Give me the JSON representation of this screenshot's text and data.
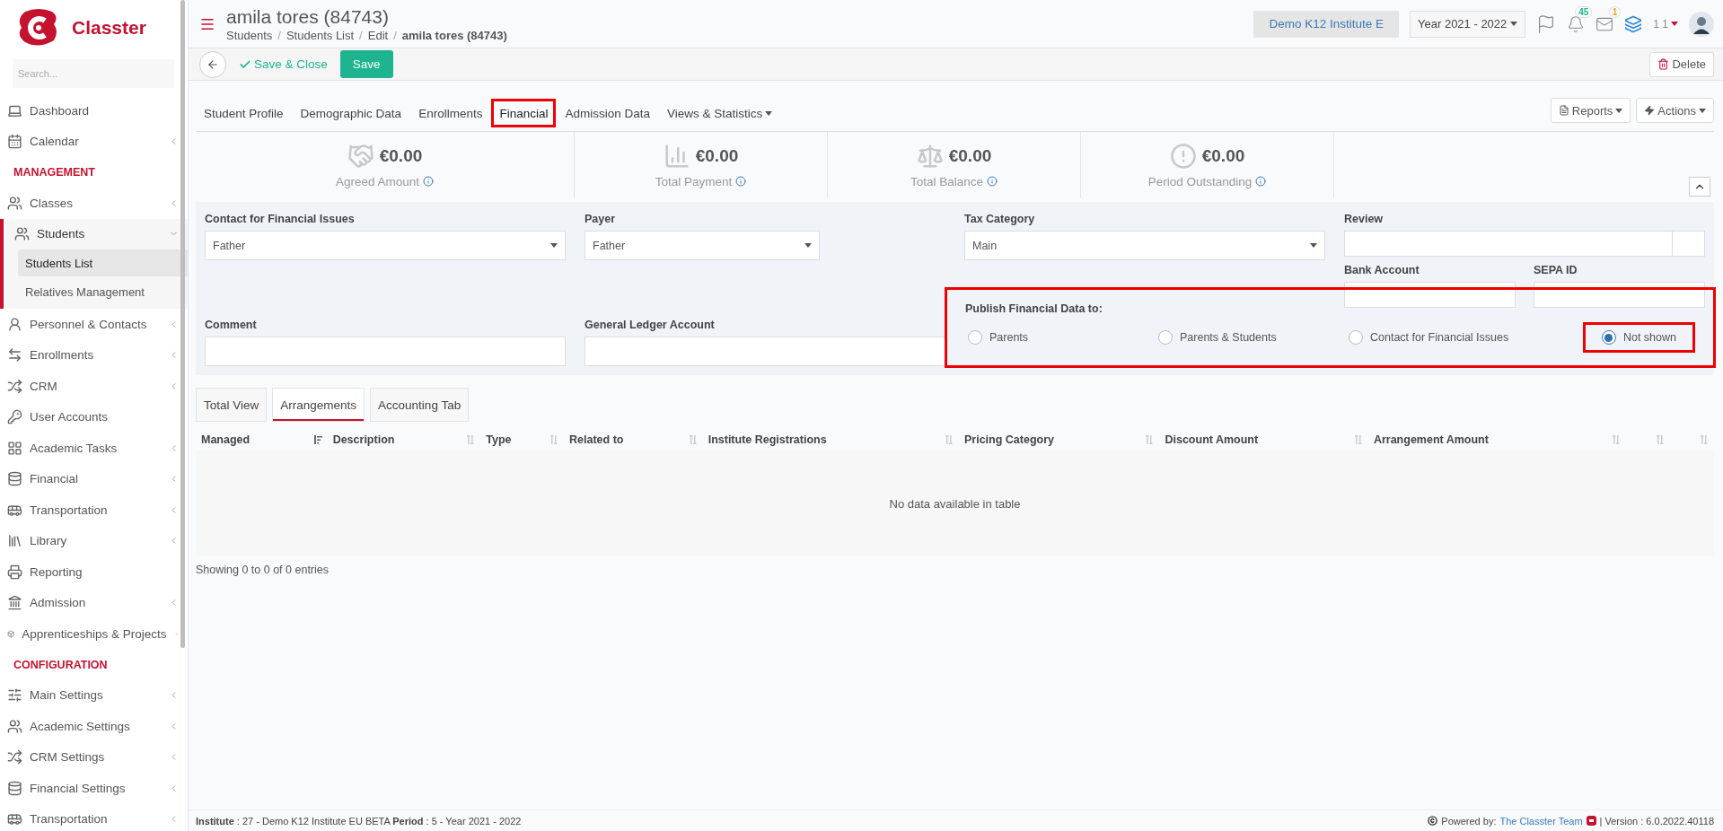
{
  "sidebar": {
    "logo_text": "Classter",
    "search": {
      "placeholder": "Search..."
    },
    "items": [
      {
        "kind": "item",
        "label": "Dashboard",
        "expandable": false,
        "expanded": false
      },
      {
        "kind": "item",
        "label": "Calendar",
        "expandable": true,
        "expanded": false
      },
      {
        "kind": "section",
        "label": "MANAGEMENT"
      },
      {
        "kind": "item",
        "label": "Classes",
        "expandable": true,
        "expanded": false
      },
      {
        "kind": "item",
        "label": "Students",
        "expandable": true,
        "expanded": true,
        "children": [
          {
            "label": "Students List",
            "selected": true
          },
          {
            "label": "Relatives Management",
            "selected": false
          }
        ]
      },
      {
        "kind": "item",
        "label": "Personnel & Contacts",
        "expandable": true,
        "expanded": false
      },
      {
        "kind": "item",
        "label": "Enrollments",
        "expandable": true,
        "expanded": false
      },
      {
        "kind": "item",
        "label": "CRM",
        "expandable": true,
        "expanded": false
      },
      {
        "kind": "item",
        "label": "User Accounts",
        "expandable": false,
        "expanded": false
      },
      {
        "kind": "item",
        "label": "Academic Tasks",
        "expandable": true,
        "expanded": false
      },
      {
        "kind": "item",
        "label": "Financial",
        "expandable": true,
        "expanded": false
      },
      {
        "kind": "item",
        "label": "Transportation",
        "expandable": true,
        "expanded": false
      },
      {
        "kind": "item",
        "label": "Library",
        "expandable": true,
        "expanded": false
      },
      {
        "kind": "item",
        "label": "Reporting",
        "expandable": false,
        "expanded": false
      },
      {
        "kind": "item",
        "label": "Admission",
        "expandable": true,
        "expanded": false
      },
      {
        "kind": "item",
        "label": "Apprenticeships & Projects",
        "expandable": true,
        "expanded": false
      },
      {
        "kind": "section",
        "label": "CONFIGURATION"
      },
      {
        "kind": "item",
        "label": "Main Settings",
        "expandable": true,
        "expanded": false
      },
      {
        "kind": "item",
        "label": "Academic Settings",
        "expandable": true,
        "expanded": false
      },
      {
        "kind": "item",
        "label": "CRM Settings",
        "expandable": true,
        "expanded": false
      },
      {
        "kind": "item",
        "label": "Financial Settings",
        "expandable": true,
        "expanded": false
      },
      {
        "kind": "item",
        "label": "Transportation",
        "expandable": true,
        "expanded": false
      }
    ]
  },
  "header": {
    "title": "amila tores (84743)",
    "breadcrumbs": [
      {
        "label": "Students",
        "current": false
      },
      {
        "label": "Students List",
        "current": false
      },
      {
        "label": "Edit",
        "current": false
      },
      {
        "label": "amila tores (84743)",
        "current": true
      }
    ],
    "separator": "/",
    "institute": "Demo K12 Institute E",
    "year": "Year 2021 - 2022",
    "notifications": "45",
    "messages": "1",
    "user": "1 1"
  },
  "toolbar": {
    "save_close": "Save & Close",
    "save": "Save",
    "delete": "Delete"
  },
  "tabs": [
    {
      "label": "Student Profile",
      "selected": false,
      "dropdown": false
    },
    {
      "label": "Demographic Data",
      "selected": false,
      "dropdown": false
    },
    {
      "label": "Enrollments",
      "selected": false,
      "dropdown": false
    },
    {
      "label": "Financial",
      "selected": true,
      "dropdown": false
    },
    {
      "label": "Admission Data",
      "selected": false,
      "dropdown": false
    },
    {
      "label": "Views & Statistics",
      "selected": false,
      "dropdown": true
    }
  ],
  "tab_actions": [
    "Reports",
    "Actions"
  ],
  "summary": [
    {
      "amount": "€0.00",
      "label": "Agreed Amount"
    },
    {
      "amount": "€0.00",
      "label": "Total Payment"
    },
    {
      "amount": "€0.00",
      "label": "Total Balance"
    },
    {
      "amount": "€0.00",
      "label": "Period Outstanding"
    }
  ],
  "form": {
    "contact": {
      "label": "Contact for Financial Issues",
      "value": "Father"
    },
    "payer": {
      "label": "Payer",
      "value": "Father"
    },
    "tax_category": {
      "label": "Tax Category",
      "value": "Main"
    },
    "review": {
      "label": "Review"
    },
    "bank_account": {
      "label": "Bank Account"
    },
    "sepa_id": {
      "label": "SEPA ID"
    },
    "comment": {
      "label": "Comment"
    },
    "ledger": {
      "label": "General Ledger Account"
    },
    "publish": {
      "label": "Publish Financial Data to:",
      "options": [
        {
          "label": "Parents",
          "selected": false
        },
        {
          "label": "Parents & Students",
          "selected": false
        },
        {
          "label": "Contact for Financial Issues",
          "selected": false
        },
        {
          "label": "Not shown",
          "selected": true
        }
      ]
    }
  },
  "subtabs": [
    {
      "label": "Total View",
      "selected": false
    },
    {
      "label": "Arrangements",
      "selected": true
    },
    {
      "label": "Accounting Tab",
      "selected": false
    }
  ],
  "table": {
    "columns": [
      {
        "kind": "labeled",
        "label": "Managed",
        "sorted": true
      },
      {
        "kind": "labeled",
        "label": "Description",
        "sorted": false
      },
      {
        "kind": "labeled",
        "label": "Type",
        "sorted": false
      },
      {
        "kind": "labeled",
        "label": "Related to",
        "sorted": false
      },
      {
        "kind": "labeled",
        "label": "Institute Registrations",
        "sorted": false
      },
      {
        "kind": "labeled",
        "label": "Pricing Category",
        "sorted": false
      },
      {
        "kind": "labeled",
        "label": "Discount Amount",
        "sorted": false
      },
      {
        "kind": "labeled",
        "label": "Arrangement Amount",
        "sorted": false
      },
      {
        "kind": "blank",
        "sorted": false
      },
      {
        "kind": "blank",
        "sorted": false
      }
    ],
    "empty_message": "No data available in table",
    "info": "Showing 0 to 0 of 0 entries"
  },
  "footer": {
    "context": "**Institute** : 27 - Demo K12 Institute EU BETA **Period** : 5 - Year 2021 - 2022",
    "powered_by": "Powered by:",
    "link": "The Classter Team",
    "version": "| Version : 6.0.2022.40118"
  }
}
